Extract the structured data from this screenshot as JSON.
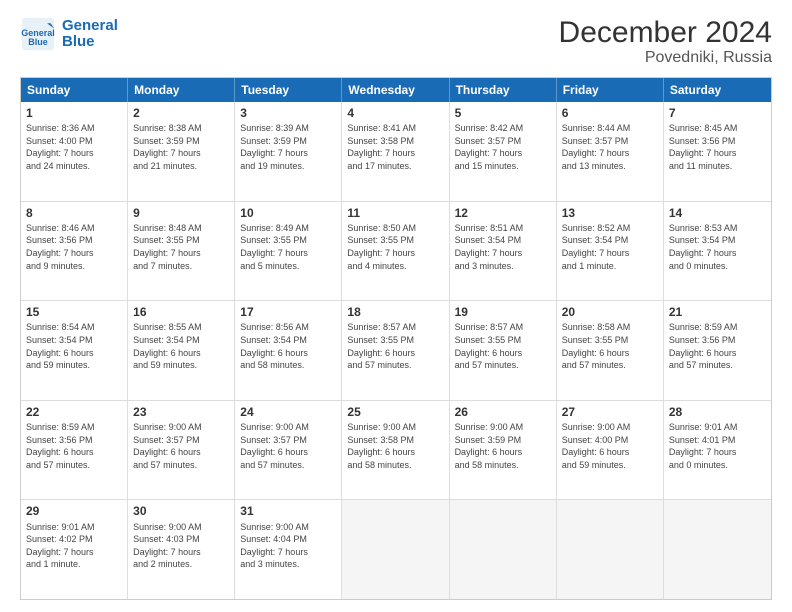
{
  "logo": {
    "line1": "General",
    "line2": "Blue"
  },
  "title": "December 2024",
  "subtitle": "Povedniki, Russia",
  "weekdays": [
    "Sunday",
    "Monday",
    "Tuesday",
    "Wednesday",
    "Thursday",
    "Friday",
    "Saturday"
  ],
  "rows": [
    [
      {
        "day": "1",
        "info": "Sunrise: 8:36 AM\nSunset: 4:00 PM\nDaylight: 7 hours\nand 24 minutes."
      },
      {
        "day": "2",
        "info": "Sunrise: 8:38 AM\nSunset: 3:59 PM\nDaylight: 7 hours\nand 21 minutes."
      },
      {
        "day": "3",
        "info": "Sunrise: 8:39 AM\nSunset: 3:59 PM\nDaylight: 7 hours\nand 19 minutes."
      },
      {
        "day": "4",
        "info": "Sunrise: 8:41 AM\nSunset: 3:58 PM\nDaylight: 7 hours\nand 17 minutes."
      },
      {
        "day": "5",
        "info": "Sunrise: 8:42 AM\nSunset: 3:57 PM\nDaylight: 7 hours\nand 15 minutes."
      },
      {
        "day": "6",
        "info": "Sunrise: 8:44 AM\nSunset: 3:57 PM\nDaylight: 7 hours\nand 13 minutes."
      },
      {
        "day": "7",
        "info": "Sunrise: 8:45 AM\nSunset: 3:56 PM\nDaylight: 7 hours\nand 11 minutes."
      }
    ],
    [
      {
        "day": "8",
        "info": "Sunrise: 8:46 AM\nSunset: 3:56 PM\nDaylight: 7 hours\nand 9 minutes."
      },
      {
        "day": "9",
        "info": "Sunrise: 8:48 AM\nSunset: 3:55 PM\nDaylight: 7 hours\nand 7 minutes."
      },
      {
        "day": "10",
        "info": "Sunrise: 8:49 AM\nSunset: 3:55 PM\nDaylight: 7 hours\nand 5 minutes."
      },
      {
        "day": "11",
        "info": "Sunrise: 8:50 AM\nSunset: 3:55 PM\nDaylight: 7 hours\nand 4 minutes."
      },
      {
        "day": "12",
        "info": "Sunrise: 8:51 AM\nSunset: 3:54 PM\nDaylight: 7 hours\nand 3 minutes."
      },
      {
        "day": "13",
        "info": "Sunrise: 8:52 AM\nSunset: 3:54 PM\nDaylight: 7 hours\nand 1 minute."
      },
      {
        "day": "14",
        "info": "Sunrise: 8:53 AM\nSunset: 3:54 PM\nDaylight: 7 hours\nand 0 minutes."
      }
    ],
    [
      {
        "day": "15",
        "info": "Sunrise: 8:54 AM\nSunset: 3:54 PM\nDaylight: 6 hours\nand 59 minutes."
      },
      {
        "day": "16",
        "info": "Sunrise: 8:55 AM\nSunset: 3:54 PM\nDaylight: 6 hours\nand 59 minutes."
      },
      {
        "day": "17",
        "info": "Sunrise: 8:56 AM\nSunset: 3:54 PM\nDaylight: 6 hours\nand 58 minutes."
      },
      {
        "day": "18",
        "info": "Sunrise: 8:57 AM\nSunset: 3:55 PM\nDaylight: 6 hours\nand 57 minutes."
      },
      {
        "day": "19",
        "info": "Sunrise: 8:57 AM\nSunset: 3:55 PM\nDaylight: 6 hours\nand 57 minutes."
      },
      {
        "day": "20",
        "info": "Sunrise: 8:58 AM\nSunset: 3:55 PM\nDaylight: 6 hours\nand 57 minutes."
      },
      {
        "day": "21",
        "info": "Sunrise: 8:59 AM\nSunset: 3:56 PM\nDaylight: 6 hours\nand 57 minutes."
      }
    ],
    [
      {
        "day": "22",
        "info": "Sunrise: 8:59 AM\nSunset: 3:56 PM\nDaylight: 6 hours\nand 57 minutes."
      },
      {
        "day": "23",
        "info": "Sunrise: 9:00 AM\nSunset: 3:57 PM\nDaylight: 6 hours\nand 57 minutes."
      },
      {
        "day": "24",
        "info": "Sunrise: 9:00 AM\nSunset: 3:57 PM\nDaylight: 6 hours\nand 57 minutes."
      },
      {
        "day": "25",
        "info": "Sunrise: 9:00 AM\nSunset: 3:58 PM\nDaylight: 6 hours\nand 58 minutes."
      },
      {
        "day": "26",
        "info": "Sunrise: 9:00 AM\nSunset: 3:59 PM\nDaylight: 6 hours\nand 58 minutes."
      },
      {
        "day": "27",
        "info": "Sunrise: 9:00 AM\nSunset: 4:00 PM\nDaylight: 6 hours\nand 59 minutes."
      },
      {
        "day": "28",
        "info": "Sunrise: 9:01 AM\nSunset: 4:01 PM\nDaylight: 7 hours\nand 0 minutes."
      }
    ],
    [
      {
        "day": "29",
        "info": "Sunrise: 9:01 AM\nSunset: 4:02 PM\nDaylight: 7 hours\nand 1 minute."
      },
      {
        "day": "30",
        "info": "Sunrise: 9:00 AM\nSunset: 4:03 PM\nDaylight: 7 hours\nand 2 minutes."
      },
      {
        "day": "31",
        "info": "Sunrise: 9:00 AM\nSunset: 4:04 PM\nDaylight: 7 hours\nand 3 minutes."
      },
      {
        "day": "",
        "info": ""
      },
      {
        "day": "",
        "info": ""
      },
      {
        "day": "",
        "info": ""
      },
      {
        "day": "",
        "info": ""
      }
    ]
  ]
}
